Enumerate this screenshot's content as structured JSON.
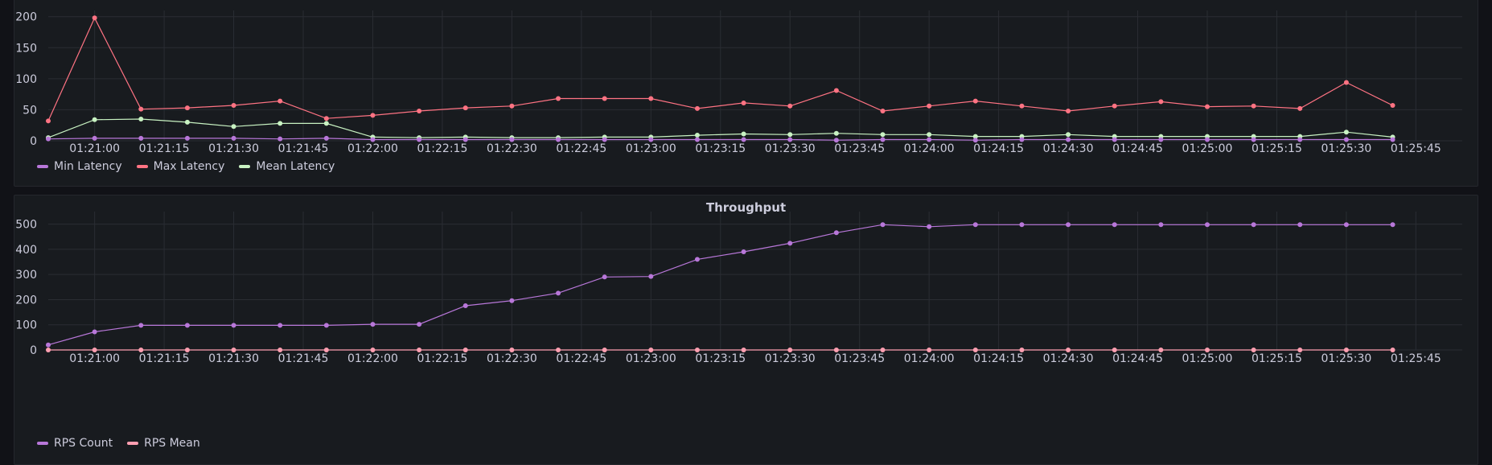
{
  "chart_data": [
    {
      "type": "line",
      "title": "",
      "xlabel": "",
      "ylabel": "",
      "ylim": [
        0,
        210
      ],
      "yticks": [
        0,
        50,
        100,
        150,
        200
      ],
      "xticks": [
        "01:21:00",
        "01:21:15",
        "01:21:30",
        "01:21:45",
        "01:22:00",
        "01:22:15",
        "01:22:30",
        "01:22:45",
        "01:23:00",
        "01:23:15",
        "01:23:30",
        "01:23:45",
        "01:24:00",
        "01:24:15",
        "01:24:30",
        "01:24:45",
        "01:25:00",
        "01:25:15",
        "01:25:30",
        "01:25:45"
      ],
      "x": [
        "01:20:50",
        "01:21:00",
        "01:21:10",
        "01:21:20",
        "01:21:30",
        "01:21:40",
        "01:21:50",
        "01:22:00",
        "01:22:10",
        "01:22:20",
        "01:22:30",
        "01:22:40",
        "01:22:50",
        "01:23:00",
        "01:23:10",
        "01:23:20",
        "01:23:30",
        "01:23:40",
        "01:23:50",
        "01:24:00",
        "01:24:10",
        "01:24:20",
        "01:24:30",
        "01:24:40",
        "01:24:50",
        "01:25:00",
        "01:25:10",
        "01:25:20",
        "01:25:30",
        "01:25:40"
      ],
      "series": [
        {
          "name": "Min Latency",
          "color": "#b877d9",
          "values": [
            3,
            4,
            4,
            4,
            4,
            3,
            4,
            2,
            2,
            2,
            2,
            2,
            2,
            2,
            2,
            2,
            2,
            1,
            2,
            2,
            1,
            2,
            2,
            2,
            2,
            2,
            2,
            2,
            2,
            2
          ]
        },
        {
          "name": "Max Latency",
          "color": "#ff7383",
          "values": [
            32,
            198,
            51,
            53,
            57,
            64,
            36,
            41,
            48,
            53,
            56,
            68,
            68,
            68,
            52,
            61,
            56,
            81,
            48,
            56,
            64,
            56,
            48,
            56,
            63,
            55,
            56,
            52,
            94,
            57
          ]
        },
        {
          "name": "Mean Latency",
          "color": "#c8f2c2",
          "values": [
            5,
            34,
            35,
            30,
            23,
            28,
            28,
            6,
            5,
            6,
            5,
            5,
            6,
            6,
            9,
            11,
            10,
            12,
            10,
            10,
            7,
            7,
            10,
            7,
            7,
            7,
            7,
            7,
            14,
            6
          ]
        }
      ],
      "legend": "bottom-left",
      "grid": true
    },
    {
      "type": "line",
      "title": "Throughput",
      "xlabel": "",
      "ylabel": "",
      "ylim": [
        0,
        550
      ],
      "yticks": [
        0,
        100,
        200,
        300,
        400,
        500
      ],
      "xticks": [
        "01:21:00",
        "01:21:15",
        "01:21:30",
        "01:21:45",
        "01:22:00",
        "01:22:15",
        "01:22:30",
        "01:22:45",
        "01:23:00",
        "01:23:15",
        "01:23:30",
        "01:23:45",
        "01:24:00",
        "01:24:15",
        "01:24:30",
        "01:24:45",
        "01:25:00",
        "01:25:15",
        "01:25:30",
        "01:25:45"
      ],
      "x": [
        "01:20:50",
        "01:21:00",
        "01:21:10",
        "01:21:20",
        "01:21:30",
        "01:21:40",
        "01:21:50",
        "01:22:00",
        "01:22:10",
        "01:22:20",
        "01:22:30",
        "01:22:40",
        "01:22:50",
        "01:23:00",
        "01:23:10",
        "01:23:20",
        "01:23:30",
        "01:23:40",
        "01:23:50",
        "01:24:00",
        "01:24:10",
        "01:24:20",
        "01:24:30",
        "01:24:40",
        "01:24:50",
        "01:25:00",
        "01:25:10",
        "01:25:20",
        "01:25:30",
        "01:25:40"
      ],
      "series": [
        {
          "name": "RPS Count",
          "color": "#b877d9",
          "values": [
            20,
            72,
            98,
            98,
            98,
            98,
            98,
            102,
            102,
            176,
            196,
            226,
            290,
            292,
            360,
            390,
            424,
            466,
            498,
            490,
            498,
            498,
            498,
            498,
            498,
            498,
            498,
            498,
            498,
            498
          ]
        },
        {
          "name": "RPS Mean",
          "color": "#ff9fb1",
          "values": [
            0,
            0,
            0,
            0,
            0,
            0,
            0,
            0,
            0,
            0,
            0,
            0,
            0,
            0,
            0,
            0,
            0,
            0,
            0,
            0,
            0,
            0,
            0,
            0,
            0,
            0,
            0,
            0,
            0,
            0
          ]
        }
      ],
      "legend": "bottom-left",
      "grid": true
    }
  ]
}
